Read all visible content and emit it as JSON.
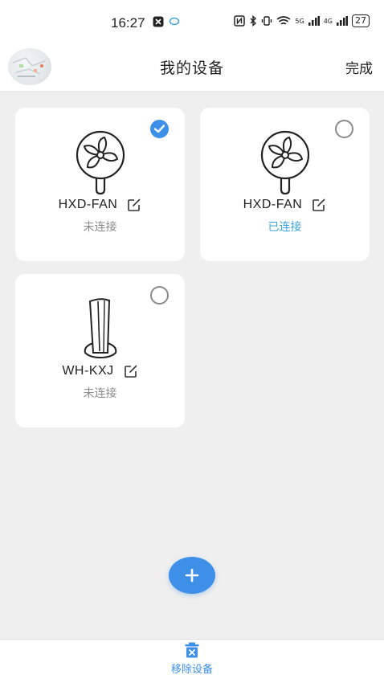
{
  "status_bar": {
    "time": "16:27",
    "battery": "27",
    "signal_1": "5G",
    "signal_2": "4G"
  },
  "header": {
    "title": "我的设备",
    "done_label": "完成"
  },
  "devices": [
    {
      "name": "HXD-FAN",
      "status": "未连接",
      "selected": true,
      "type": "fan-icon"
    },
    {
      "name": "HXD-FAN",
      "status": "已连接",
      "selected": false,
      "type": "fan-icon"
    },
    {
      "name": "WH-KXJ",
      "status": "未连接",
      "selected": false,
      "type": "tower-fan-icon"
    }
  ],
  "bottom_bar": {
    "remove_label": "移除设备"
  },
  "colors": {
    "accent": "#3d8fe8",
    "connected": "#3aa5d8",
    "disconnected": "#8c8c8c",
    "background": "#efefef"
  }
}
